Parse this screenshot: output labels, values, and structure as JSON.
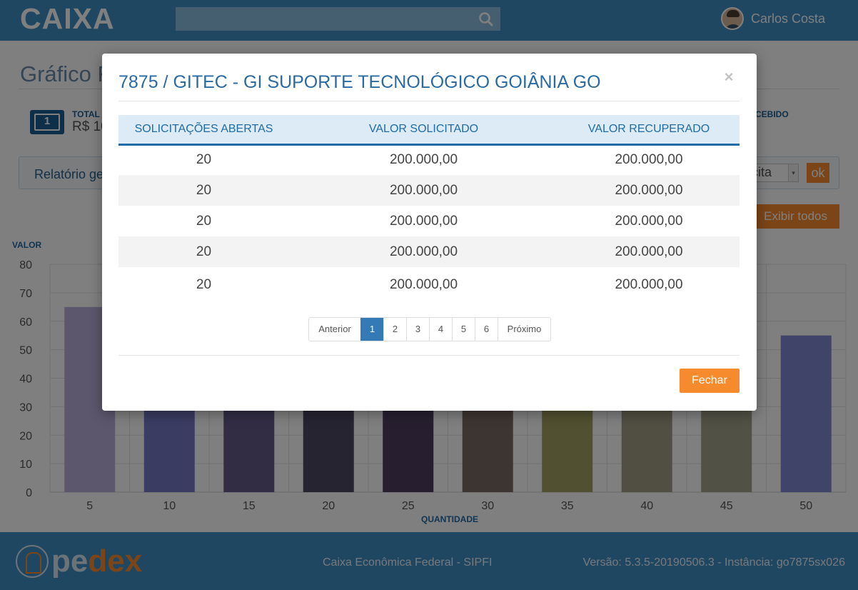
{
  "header": {
    "logo_text": "CAIXA",
    "search_placeholder": "",
    "user_name": "Carlos Costa"
  },
  "page": {
    "title": "Gráfico R",
    "total_label": "TOTAL",
    "total_value": "R$ 10",
    "received_label": "CEBIDO",
    "report_title": "Relatório ger",
    "report_select_value": "licita",
    "ok_label": "ok",
    "show_all_label": "Exibir todos"
  },
  "chart_data": {
    "type": "bar",
    "ylabel": "VALOR",
    "xlabel": "QUANTIDADE",
    "ylim": [
      0,
      80
    ],
    "yticks": [
      "0",
      "10",
      "20",
      "30",
      "40",
      "50",
      "60",
      "70",
      "80"
    ],
    "categories": [
      "5",
      "10",
      "15",
      "20",
      "25",
      "30",
      "35",
      "40",
      "45",
      "50"
    ],
    "values": [
      65,
      30,
      30,
      30,
      30,
      30,
      30,
      30,
      30,
      55
    ],
    "colors": [
      "#b9aedb",
      "#7478c2",
      "#655a8a",
      "#4e4865",
      "#4f3f5e",
      "#7a6b62",
      "#a3a160",
      "#a29f84",
      "#a2a38b",
      "#8088d1"
    ],
    "grid": true
  },
  "footer": {
    "org": "Caixa Econômica Federal - SIPFI",
    "version": "Versão: 5.3.5-20190506.3 - Instância: go7875sx026",
    "logo_text_a": "pe",
    "logo_text_b": "de",
    "logo_text_c": "x"
  },
  "modal": {
    "title": "7875 / GITEC - GI SUPORTE TECNOLÓGICO GOIÂNIA GO",
    "close_symbol": "×",
    "columns": [
      "SOLICITAÇÕES ABERTAS",
      "VALOR SOLICITADO",
      "VALOR RECUPERADO"
    ],
    "rows": [
      [
        "20",
        "200.000,00",
        "200.000,00"
      ],
      [
        "20",
        "200.000,00",
        "200.000,00"
      ],
      [
        "20",
        "200.000,00",
        "200.000,00"
      ],
      [
        "20",
        "200.000,00",
        "200.000,00"
      ],
      [
        "20",
        "200.000,00",
        "200.000,00"
      ]
    ],
    "pagination": {
      "prev": "Anterior",
      "pages": [
        "1",
        "2",
        "3",
        "4",
        "5",
        "6"
      ],
      "current": "1",
      "next": "Próximo"
    },
    "close_button": "Fechar"
  }
}
